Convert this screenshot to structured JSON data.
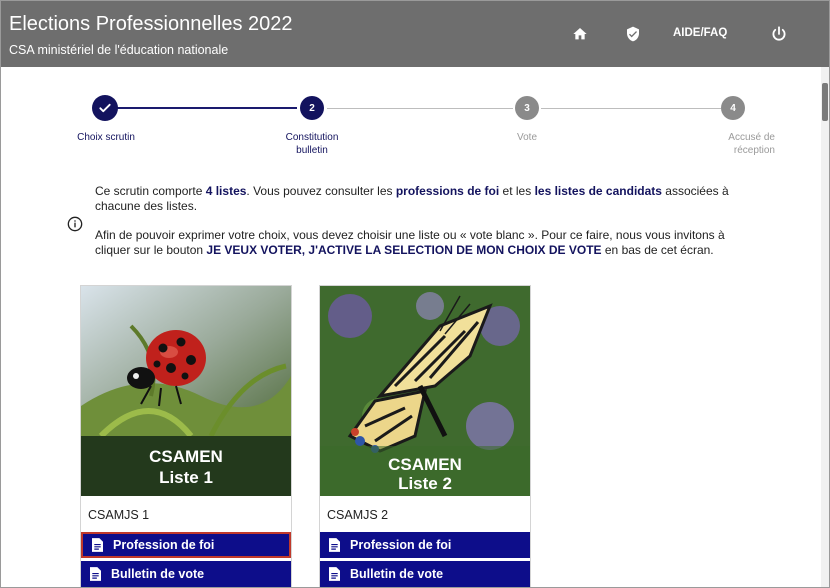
{
  "header": {
    "title": "Elections Professionnelles 2022",
    "subtitle": "CSA ministériel de l'éducation nationale",
    "help_label": "AIDE/FAQ",
    "icons": [
      "home-icon",
      "shield-check-icon",
      "power-icon"
    ]
  },
  "stepper": {
    "steps": [
      {
        "number": "",
        "label_line1": "Choix scrutin",
        "label_line2": "",
        "state": "done"
      },
      {
        "number": "2",
        "label_line1": "Constitution",
        "label_line2": "bulletin",
        "state": "active"
      },
      {
        "number": "3",
        "label_line1": "Vote",
        "label_line2": "",
        "state": "todo"
      },
      {
        "number": "4",
        "label_line1": "Accusé de",
        "label_line2": "réception",
        "state": "todo"
      }
    ]
  },
  "info": {
    "p1_a": "Ce scrutin comporte ",
    "p1_b": "4 listes",
    "p1_c": ". Vous pouvez consulter les ",
    "p1_d": "professions de foi",
    "p1_e": " et les ",
    "p1_f": "les listes de candidats",
    "p1_g": " associées à chacune des listes.",
    "p2_a": "Afin de pouvoir exprimer votre choix, vous devez choisir une liste ou « vote blanc ». Pour ce faire, nous vous invitons à cliquer sur le bouton ",
    "p2_b": "JE VEUX VOTER, J'ACTIVE LA SELECTION DE MON CHOIX DE VOTE",
    "p2_c": " en bas de cet écran."
  },
  "cards": [
    {
      "image_title": "CSAMEN",
      "image_subtitle": "Liste 1",
      "name": "CSAMJS 1",
      "profession_label": "Profession de foi",
      "bulletin_label": "Bulletin de vote"
    },
    {
      "image_title": "CSAMEN",
      "image_subtitle": "Liste 2",
      "name": "CSAMJS 2",
      "profession_label": "Profession de foi",
      "bulletin_label": "Bulletin de vote"
    }
  ],
  "colors": {
    "header_bg": "#6e6e6e",
    "accent_navy": "#13135e",
    "button_blue": "#0d0d8a",
    "focus_red": "#c0392b"
  }
}
